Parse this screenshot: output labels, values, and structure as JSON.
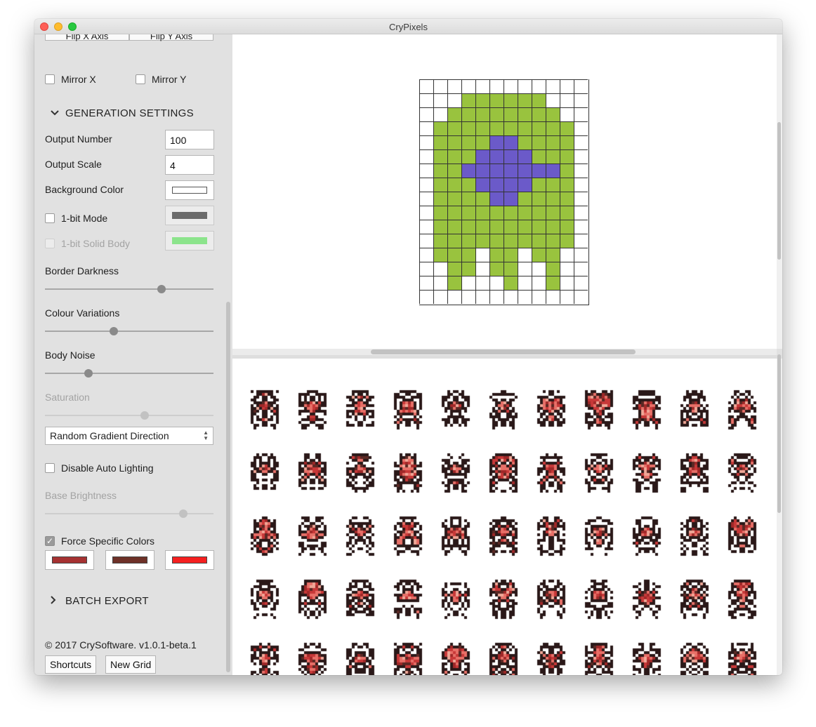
{
  "window": {
    "title": "CryPixels"
  },
  "sidebar": {
    "flip_x_label": "Flip X Axis",
    "flip_y_label": "Flip Y Axis",
    "mirror_x": {
      "label": "Mirror X",
      "checked": false
    },
    "mirror_y": {
      "label": "Mirror Y",
      "checked": false
    },
    "generation_section": {
      "title": "GENERATION SETTINGS",
      "expanded": true
    },
    "output_number": {
      "label": "Output Number",
      "value": "100"
    },
    "output_scale": {
      "label": "Output Scale",
      "value": "4"
    },
    "background_color": {
      "label": "Background Color",
      "color": "#ffffff"
    },
    "one_bit_mode": {
      "label": "1-bit Mode",
      "checked": false,
      "color": "#6b6b6b"
    },
    "one_bit_solid": {
      "label": "1-bit Solid Body",
      "checked": false,
      "disabled": true,
      "color": "#8ce48c"
    },
    "border_darkness": {
      "label": "Border Darkness",
      "value": 0.69
    },
    "colour_variations": {
      "label": "Colour Variations",
      "value": 0.41
    },
    "body_noise": {
      "label": "Body Noise",
      "value": 0.26
    },
    "saturation": {
      "label": "Saturation",
      "value": 0.59,
      "disabled": true
    },
    "gradient_direction": {
      "selected": "Random Gradient Direction"
    },
    "disable_auto_lighting": {
      "label": "Disable Auto Lighting",
      "checked": false
    },
    "base_brightness": {
      "label": "Base Brightness",
      "value": 0.82,
      "disabled": true
    },
    "force_specific_colors": {
      "label": "Force Specific Colors",
      "checked": true,
      "check_glyph": "✓"
    },
    "forced_colors": [
      "#a63232",
      "#6e3128",
      "#f52020"
    ],
    "batch_section": {
      "title": "BATCH EXPORT",
      "expanded": false
    },
    "copyright": "© 2017 CrySoftware. v1.0.1-beta.1",
    "shortcuts_label": "Shortcuts",
    "new_grid_label": "New Grid",
    "icons": {
      "expanded_chevron": "chevron-down-icon",
      "collapsed_chevron": "chevron-right-icon",
      "select_arrows": "up-down-arrows-icon"
    }
  },
  "editor": {
    "grid": {
      "columns": 12,
      "rows": 16,
      "colors": {
        "body": "#99c33e",
        "core": "#6b5ac9",
        "empty": "#ffffff",
        "line": "#333333"
      },
      "cells": [
        "............",
        "...gggggg...",
        "..gggggggg..",
        ".gggggggggg.",
        ".ggggppgggg.",
        ".gggppppggg.",
        ".ggpppppppg.",
        ".gggppppggg.",
        ".ggggppgggg.",
        ".gggggggggg.",
        ".gggggggggg.",
        ".gggggggggg.",
        ".ggg.gg.gg..",
        "..gg.gg..g..",
        "..g...g..g..",
        "............"
      ]
    }
  },
  "preview": {
    "columns": 11,
    "rows": 5,
    "palette": [
      "#f0a898",
      "#e87068",
      "#c83838",
      "#a02828",
      "#5a2824",
      "#2a1818"
    ]
  }
}
